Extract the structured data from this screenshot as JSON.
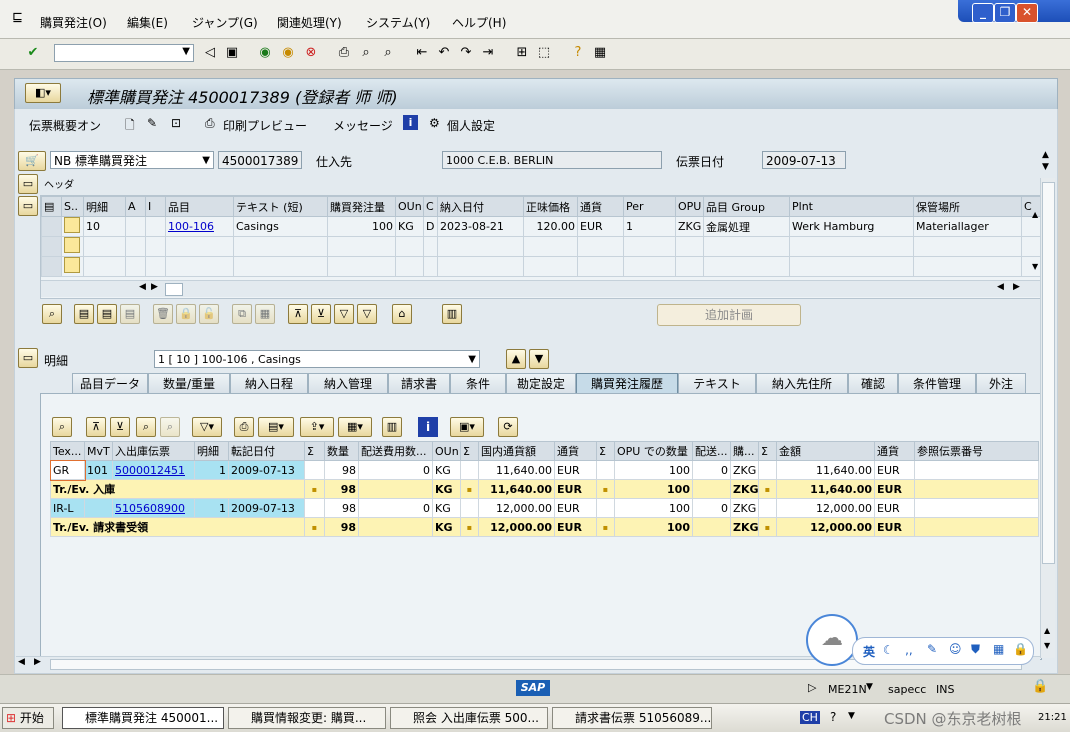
{
  "menubar": {
    "items": [
      "購買発注(O)",
      "編集(E)",
      "ジャンプ(G)",
      "関連処理(Y)",
      "システム(Y)",
      "ヘルプ(H)"
    ]
  },
  "title": "標準購買発注 4500017389 (登録者 师 师)",
  "app_toolbar": {
    "doc_overview": "伝票概要オン",
    "print_preview": "印刷プレビュー",
    "messages": "メッセージ",
    "personal_settings": "個人設定"
  },
  "header": {
    "po_type": "NB 標準購買発注",
    "po_number": "4500017389",
    "vendor_label": "仕入先",
    "vendor_value": "1000 C.E.B. BERLIN",
    "doc_date_label": "伝票日付",
    "doc_date_value": "2009-07-13",
    "header_section": "ヘッダ"
  },
  "item_grid": {
    "columns": [
      "S..",
      "明細",
      "A",
      "I",
      "品目",
      "テキスト (短)",
      "購買発注量",
      "OUn",
      "C",
      "納入日付",
      "正味価格",
      "通貨",
      "Per",
      "OPU",
      "品目 Group",
      "Plnt",
      "保管場所",
      "C"
    ],
    "row": [
      "",
      "10",
      "",
      "",
      "100-106",
      "Casings",
      "100",
      "KG",
      "D",
      "2023-08-21",
      "120.00",
      "EUR",
      "1",
      "ZKG",
      "金属処理",
      "Werk Hamburg",
      "Materiallager",
      ""
    ],
    "add_plan_button": "追加計画"
  },
  "item_detail": {
    "label": "明細",
    "selected": "1 [ 10 ] 100-106 , Casings"
  },
  "tabs": [
    "品目データ",
    "数量/重量",
    "納入日程",
    "納入管理",
    "請求書",
    "条件",
    "勘定設定",
    "購買発注履歴",
    "テキスト",
    "納入先住所",
    "確認",
    "条件管理",
    "外注"
  ],
  "active_tab": "購買発注履歴",
  "history": {
    "columns": [
      "Tex...",
      "MvT",
      "入出庫伝票",
      "明細",
      "転記日付",
      "Σ",
      "数量",
      "配送費用数...",
      "OUn",
      "Σ",
      "国内通貨額",
      "通貨",
      "Σ",
      "OPU での数量",
      "配送...",
      "購...",
      "Σ",
      "金額",
      "通貨",
      "参照伝票番号"
    ],
    "rows": [
      {
        "type": "GR",
        "mvt": "101",
        "doc": "5000012451",
        "item": "1",
        "date": "2009-07-13",
        "qty": "98",
        "del_cost": "0",
        "oun": "KG",
        "local_amt": "11,640.00",
        "cur": "EUR",
        "opu_qty": "100",
        "del": "0",
        "opu": "ZKG",
        "amount": "11,640.00",
        "cur2": "EUR"
      },
      {
        "sum": true,
        "label": "Tr./Ev. 入庫",
        "qty": "98",
        "oun": "KG",
        "local_amt": "11,640.00",
        "cur": "EUR",
        "opu_qty": "100",
        "opu": "ZKG",
        "amount": "11,640.00",
        "cur2": "EUR"
      },
      {
        "type": "IR-L",
        "mvt": "",
        "doc": "5105608900",
        "item": "1",
        "date": "2009-07-13",
        "qty": "98",
        "del_cost": "0",
        "oun": "KG",
        "local_amt": "12,000.00",
        "cur": "EUR",
        "opu_qty": "100",
        "del": "0",
        "opu": "ZKG",
        "amount": "12,000.00",
        "cur2": "EUR"
      },
      {
        "sum": true,
        "label": "Tr./Ev. 請求書受領",
        "qty": "98",
        "oun": "KG",
        "local_amt": "12,000.00",
        "cur": "EUR",
        "opu_qty": "100",
        "opu": "ZKG",
        "amount": "12,000.00",
        "cur2": "EUR"
      }
    ]
  },
  "statusbar": {
    "brand": "SAP",
    "tcode": "ME21N",
    "system": "sapecc",
    "mode": "INS"
  },
  "ime_bar": {
    "lang": "英"
  },
  "taskbar": {
    "start": "开始",
    "tasks": [
      "標準購買発注 450001...",
      "購買情報変更: 購買...",
      "照会 入出庫伝票 500...",
      "請求書伝票 51056089..."
    ],
    "lang": "CH",
    "time": "21:21",
    "watermark": "CSDN @东京老树根"
  }
}
